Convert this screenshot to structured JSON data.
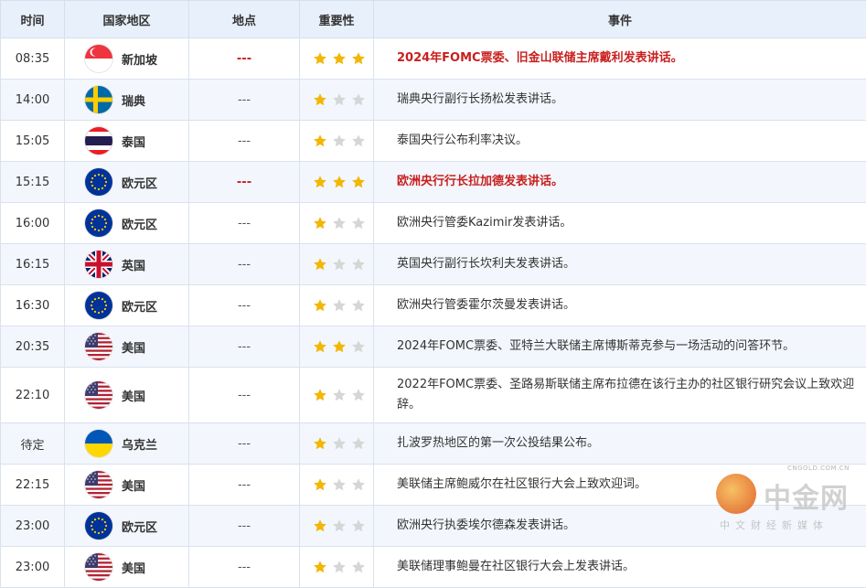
{
  "headers": {
    "time": "时间",
    "country": "国家地区",
    "place": "地点",
    "importance": "重要性",
    "event": "事件"
  },
  "rows": [
    {
      "time": "08:35",
      "flag": "sg",
      "country": "新加坡",
      "place": "---",
      "stars": 3,
      "highlight": true,
      "event": "2024年FOMC票委、旧金山联储主席戴利发表讲话。"
    },
    {
      "time": "14:00",
      "flag": "se",
      "country": "瑞典",
      "place": "---",
      "stars": 1,
      "highlight": false,
      "event": "瑞典央行副行长扬松发表讲话。"
    },
    {
      "time": "15:05",
      "flag": "th",
      "country": "泰国",
      "place": "---",
      "stars": 1,
      "highlight": false,
      "event": "泰国央行公布利率决议。"
    },
    {
      "time": "15:15",
      "flag": "eu",
      "country": "欧元区",
      "place": "---",
      "stars": 3,
      "highlight": true,
      "event": "欧洲央行行长拉加德发表讲话。"
    },
    {
      "time": "16:00",
      "flag": "eu",
      "country": "欧元区",
      "place": "---",
      "stars": 1,
      "highlight": false,
      "event": "欧洲央行管委Kazimir发表讲话。"
    },
    {
      "time": "16:15",
      "flag": "gb",
      "country": "英国",
      "place": "---",
      "stars": 1,
      "highlight": false,
      "event": "英国央行副行长坎利夫发表讲话。"
    },
    {
      "time": "16:30",
      "flag": "eu",
      "country": "欧元区",
      "place": "---",
      "stars": 1,
      "highlight": false,
      "event": "欧洲央行管委霍尔茨曼发表讲话。"
    },
    {
      "time": "20:35",
      "flag": "us",
      "country": "美国",
      "place": "---",
      "stars": 2,
      "highlight": false,
      "event": "2024年FOMC票委、亚特兰大联储主席博斯蒂克参与一场活动的问答环节。"
    },
    {
      "time": "22:10",
      "flag": "us",
      "country": "美国",
      "place": "---",
      "stars": 1,
      "highlight": false,
      "tall": true,
      "event": "2022年FOMC票委、圣路易斯联储主席布拉德在该行主办的社区银行研究会议上致欢迎辞。"
    },
    {
      "time": "待定",
      "flag": "ua",
      "country": "乌克兰",
      "place": "---",
      "stars": 1,
      "highlight": false,
      "event": "扎波罗热地区的第一次公投结果公布。"
    },
    {
      "time": "22:15",
      "flag": "us",
      "country": "美国",
      "place": "---",
      "stars": 1,
      "highlight": false,
      "event": "美联储主席鲍威尔在社区银行大会上致欢迎词。"
    },
    {
      "time": "23:00",
      "flag": "eu",
      "country": "欧元区",
      "place": "---",
      "stars": 1,
      "highlight": false,
      "event": "欧洲央行执委埃尔德森发表讲话。"
    },
    {
      "time": "23:00",
      "flag": "us",
      "country": "美国",
      "place": "---",
      "stars": 1,
      "highlight": false,
      "event": "美联储理事鲍曼在社区银行大会上发表讲话。"
    }
  ],
  "watermark": {
    "brand": "中金网",
    "site": "CNGOLD.COM.CN",
    "slogan": "中文财经新媒体"
  },
  "colors": {
    "highlight": "#c8201e",
    "star_on": "#f2b705",
    "star_off": "#d6d6d6",
    "header_bg": "#e8f0fb",
    "alt_row_bg": "#f3f7fd"
  }
}
